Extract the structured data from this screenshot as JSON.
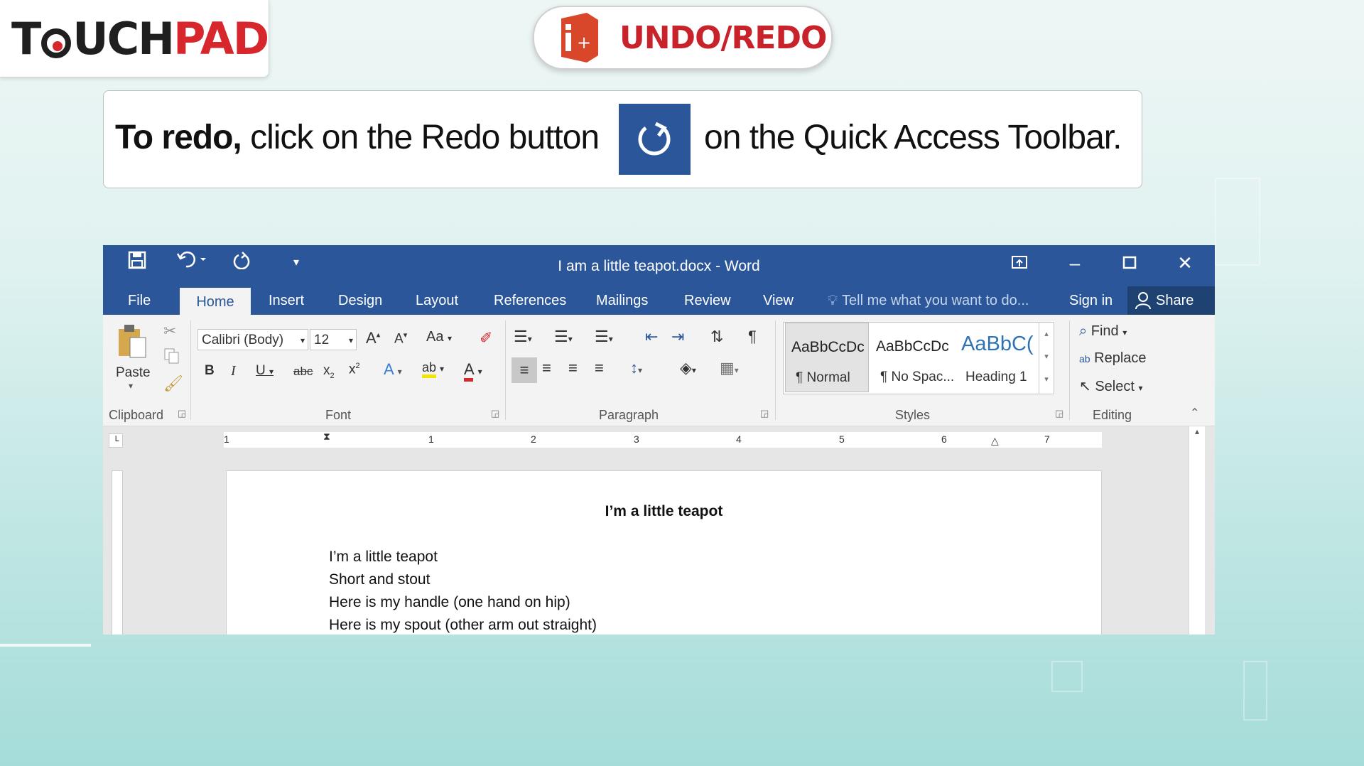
{
  "logo": {
    "part1": "T",
    "part2": "UCH",
    "part3": "PAD"
  },
  "header": {
    "title": "UNDO/REDO"
  },
  "instruction": {
    "bold": "To redo,",
    "text1": " click on the Redo button",
    "text2": "on the Quick Access Toolbar."
  },
  "word": {
    "title": "I am a little teapot.docx - Word",
    "tabs": [
      "File",
      "Home",
      "Insert",
      "Design",
      "Layout",
      "References",
      "Mailings",
      "Review",
      "View"
    ],
    "tell_me": "Tell me what you want to do...",
    "sign_in": "Sign in",
    "share": "Share",
    "clipboard": {
      "paste": "Paste",
      "label": "Clipboard"
    },
    "font": {
      "name": "Calibri (Body)",
      "size": "12",
      "label": "Font",
      "case": "Aa"
    },
    "paragraph": {
      "label": "Paragraph"
    },
    "styles": {
      "label": "Styles",
      "items": [
        {
          "preview": "AaBbCcDc",
          "name": "¶ Normal"
        },
        {
          "preview": "AaBbCcDc",
          "name": "¶ No Spac..."
        },
        {
          "preview": "AaBbC(",
          "name": "Heading 1"
        }
      ]
    },
    "editing": {
      "label": "Editing",
      "find": "Find",
      "replace": "Replace",
      "select": "Select"
    },
    "ruler_numbers": [
      "1",
      "1",
      "2",
      "3",
      "4",
      "5",
      "6",
      "7"
    ],
    "document": {
      "heading": "I’m a little teapot",
      "lines": [
        "I’m a little teapot",
        "Short and stout",
        "Here is my handle (one hand on hip)",
        "Here is my spout (other arm out straight)"
      ]
    }
  },
  "colors": {
    "word_blue": "#2b579a",
    "brand_red": "#d7262c"
  }
}
